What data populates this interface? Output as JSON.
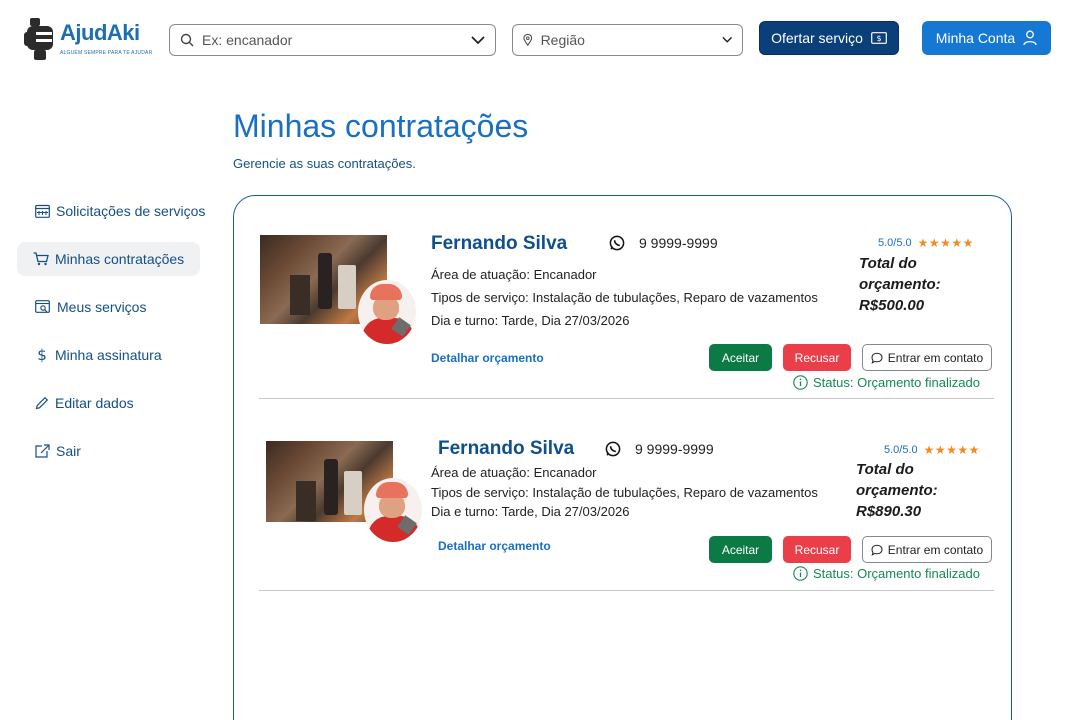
{
  "header": {
    "logo_text": "AjudAki",
    "logo_tagline": "ALGUÉM SEMPRE PARA TE AJUDAR",
    "search_placeholder": "Ex: encanador",
    "region_placeholder": "Região",
    "offer_button": "Ofertar serviço",
    "account_button": "Minha Conta"
  },
  "page": {
    "title": "Minhas contratações",
    "subtitle": "Gerencie as suas contratações."
  },
  "sidebar": {
    "items": [
      {
        "label": "Solicitações de serviços",
        "icon": "calendar-icon",
        "active": false
      },
      {
        "label": "Minhas contratações",
        "icon": "cart-icon",
        "active": true
      },
      {
        "label": "Meus serviços",
        "icon": "list-search-icon",
        "active": false
      },
      {
        "label": "Minha assinatura",
        "icon": "dollar-icon",
        "active": false
      },
      {
        "label": "Editar dados",
        "icon": "pencil-icon",
        "active": false
      },
      {
        "label": "Sair",
        "icon": "external-link-icon",
        "active": false
      }
    ]
  },
  "contracts": [
    {
      "name": "Fernando Silva",
      "phone": "9 9999-9999",
      "area": "Área de atuação: Encanador",
      "services": "Tipos de serviço: Instalação de tubulações, Reparo de vazamentos",
      "schedule": "Dia e turno: Tarde, Dia 27/03/2026",
      "detail_link": "Detalhar orçamento",
      "rating": "5.0/5.0",
      "stars": "★★★★★",
      "rating_value": 5,
      "total_label": "Total do orçamento:",
      "total_value": "R$500.00",
      "accept_label": "Aceitar",
      "refuse_label": "Recusar",
      "contact_label": "Entrar em contato",
      "status": "Status: Orçamento finalizado"
    },
    {
      "name": "Fernando Silva",
      "phone": "9 9999-9999",
      "area": "Área de atuação: Encanador",
      "services": "Tipos de serviço: Instalação de tubulações, Reparo de vazamentos",
      "schedule": "Dia e turno: Tarde, Dia 27/03/2026",
      "detail_link": "Detalhar orçamento",
      "rating": "5.0/5.0",
      "stars": "★★★★★",
      "rating_value": 5,
      "total_label": "Total do orçamento:",
      "total_value": "R$890.30",
      "accept_label": "Aceitar",
      "refuse_label": "Recusar",
      "contact_label": "Entrar em contato",
      "status": "Status: Orçamento finalizado"
    }
  ],
  "colors": {
    "brand_blue": "#1a6fc0",
    "dark_blue": "#0a3f7a",
    "accept_green": "#0b7a44",
    "refuse_red": "#ea3f48",
    "status_green": "#148a51",
    "star_orange": "#f08a24"
  }
}
